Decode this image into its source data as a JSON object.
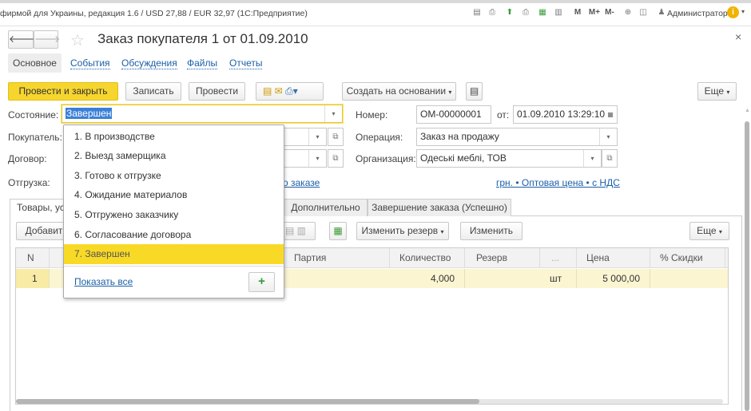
{
  "app_title": "фирмой для Украины, редакция 1.6 / USD 27,88 / EUR 32,97   (1С:Предприятие)",
  "toolbar_icons": [
    "save-icon",
    "print-icon",
    "upload-icon",
    "print-preview-icon",
    "calculator-icon",
    "calendar-icon",
    "M",
    "M+",
    "M-",
    "zoom-icon",
    "panel-icon"
  ],
  "memory_buttons": {
    "m": "M",
    "mplus": "M+",
    "mminus": "M-"
  },
  "user": "Администратор",
  "doc_title": "Заказ покупателя 1 от 01.09.2010",
  "close_label": "×",
  "nav_tabs": [
    {
      "label": "Основное"
    },
    {
      "label": "События"
    },
    {
      "label": "Обсуждения"
    },
    {
      "label": "Файлы"
    },
    {
      "label": "Отчеты"
    }
  ],
  "actions": {
    "post_close": "Провести и закрыть",
    "write": "Записать",
    "post": "Провести",
    "create_based": "Создать на основании",
    "more": "Еще"
  },
  "form": {
    "state_label": "Состояние:",
    "state_value": "Завершен",
    "number_label": "Номер:",
    "number_value": "ОМ-00000001",
    "date_label": "от:",
    "date_value": "01.09.2010 13:29:10",
    "buyer_label": "Покупатель:",
    "operation_label": "Операция:",
    "operation_value": "Заказ на продажу",
    "contract_label": "Договор:",
    "org_label": "Организация:",
    "org_value": "Одеські меблі, ТОВ",
    "shipment_label": "Отгрузка:",
    "order_info_link": "о заказе",
    "price_link": "грн. • Оптовая цена • с НДС"
  },
  "inner_tabs": [
    {
      "label": "Товары, ус"
    },
    {
      "label": "Дополнительно"
    },
    {
      "label": "Завершение заказа (Успешно)"
    }
  ],
  "table_toolbar": {
    "add": "Добавит",
    "change_reserve": "Изменить резерв",
    "change": "Изменить",
    "more": "Еще"
  },
  "table": {
    "columns": [
      "N",
      "Партия",
      "Количество",
      "Резерв",
      "...",
      "Цена",
      "% Скидки"
    ],
    "rows": [
      {
        "n": "1",
        "qty": "4,000",
        "unit": "шт",
        "price": "5 000,00"
      }
    ]
  },
  "dropdown": {
    "items": [
      "1. В производстве",
      "2. Выезд замерщика",
      "3. Готово к отгрузке",
      "4. Ожидание материалов",
      "5. Отгружено заказчику",
      "6. Согласование договора",
      "7. Завершен"
    ],
    "selected_index": 6,
    "show_all": "Показать все",
    "add": "+"
  },
  "colors": {
    "accent": "#f6d52f",
    "link": "#1b5fa8",
    "row_highlight": "#fbf5d2",
    "selection": "#3b7fd8"
  }
}
